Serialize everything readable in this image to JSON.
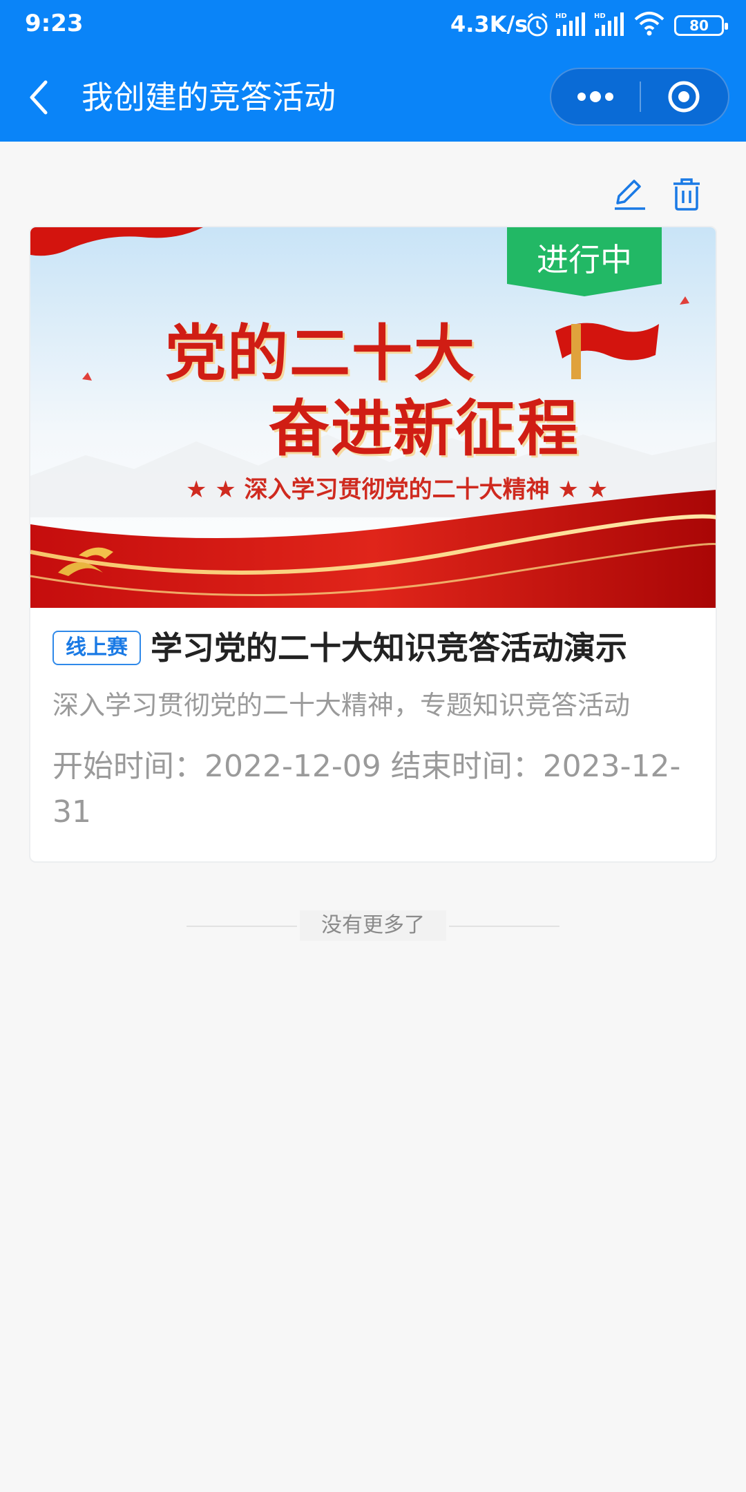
{
  "status_bar": {
    "time": "9:23",
    "speed": "4.3K/s",
    "battery": "80"
  },
  "nav": {
    "title": "我创建的竞答活动"
  },
  "card": {
    "status_label": "进行中",
    "banner": {
      "line1": "党的二十大",
      "line2": "奋进新征程",
      "subtitle": "★ ★ 深入学习贯彻党的二十大精神 ★ ★"
    },
    "tag": "线上赛",
    "title": "学习党的二十大知识竞答活动演示",
    "description": "深入学习贯彻党的二十大精神，专题知识竞答活动",
    "dates": "开始时间：2022-12-09  结束时间：2023-12-31"
  },
  "footer": {
    "no_more": "没有更多了"
  },
  "colors": {
    "primary": "#0a84f8",
    "running": "#22b865",
    "tag": "#2f89e9"
  }
}
